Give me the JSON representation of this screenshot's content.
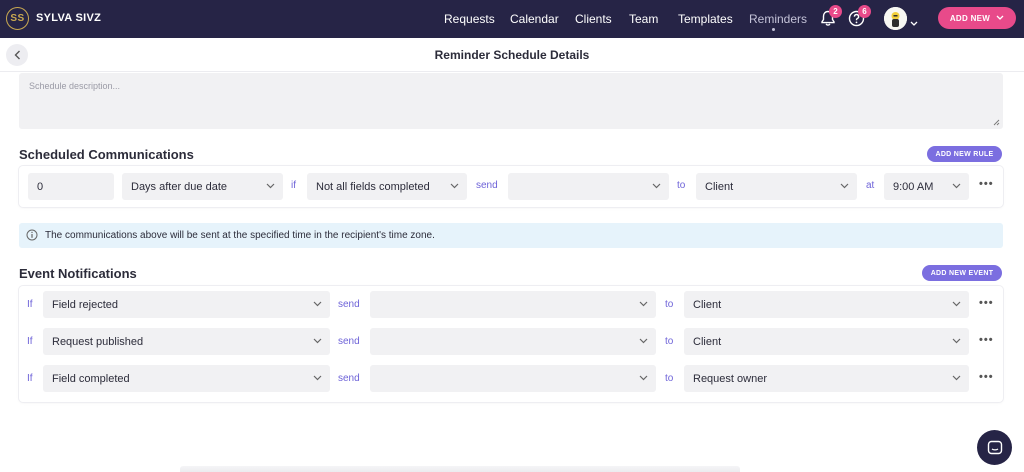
{
  "brand": {
    "initials": "SS",
    "name": "SYLVA SIVZ"
  },
  "nav": {
    "links": [
      "Requests",
      "Calendar",
      "Clients",
      "Team",
      "Templates",
      "Reminders"
    ],
    "active": "Reminders",
    "notifications_count": "2",
    "help_count": "6",
    "add_new_label": "ADD NEW"
  },
  "page": {
    "title": "Reminder Schedule Details"
  },
  "description": {
    "placeholder": "Schedule description..."
  },
  "scheduled": {
    "title": "Scheduled Communications",
    "add_button": "ADD NEW RULE",
    "rule": {
      "offset": "0",
      "timing": "Days after due date",
      "if_label": "if",
      "condition": "Not all fields completed",
      "send_label": "send",
      "template": "",
      "to_label": "to",
      "recipient": "Client",
      "at_label": "at",
      "time": "9:00 AM"
    }
  },
  "info": {
    "text": "The communications above will be sent at the specified time in the recipient's time zone."
  },
  "events": {
    "title": "Event Notifications",
    "add_button": "ADD NEW EVENT",
    "rows": [
      {
        "if_label": "If",
        "event": "Field rejected",
        "send_label": "send",
        "template": "",
        "to_label": "to",
        "recipient": "Client"
      },
      {
        "if_label": "If",
        "event": "Request published",
        "send_label": "send",
        "template": "",
        "to_label": "to",
        "recipient": "Client"
      },
      {
        "if_label": "If",
        "event": "Field completed",
        "send_label": "send",
        "template": "",
        "to_label": "to",
        "recipient": "Request owner"
      }
    ]
  },
  "more_label": "•••",
  "colors": {
    "nav_bg": "#262446",
    "accent_pink": "#e84a8a",
    "accent_purple": "#7b6ee0",
    "info_bg": "#e6f3fb"
  }
}
